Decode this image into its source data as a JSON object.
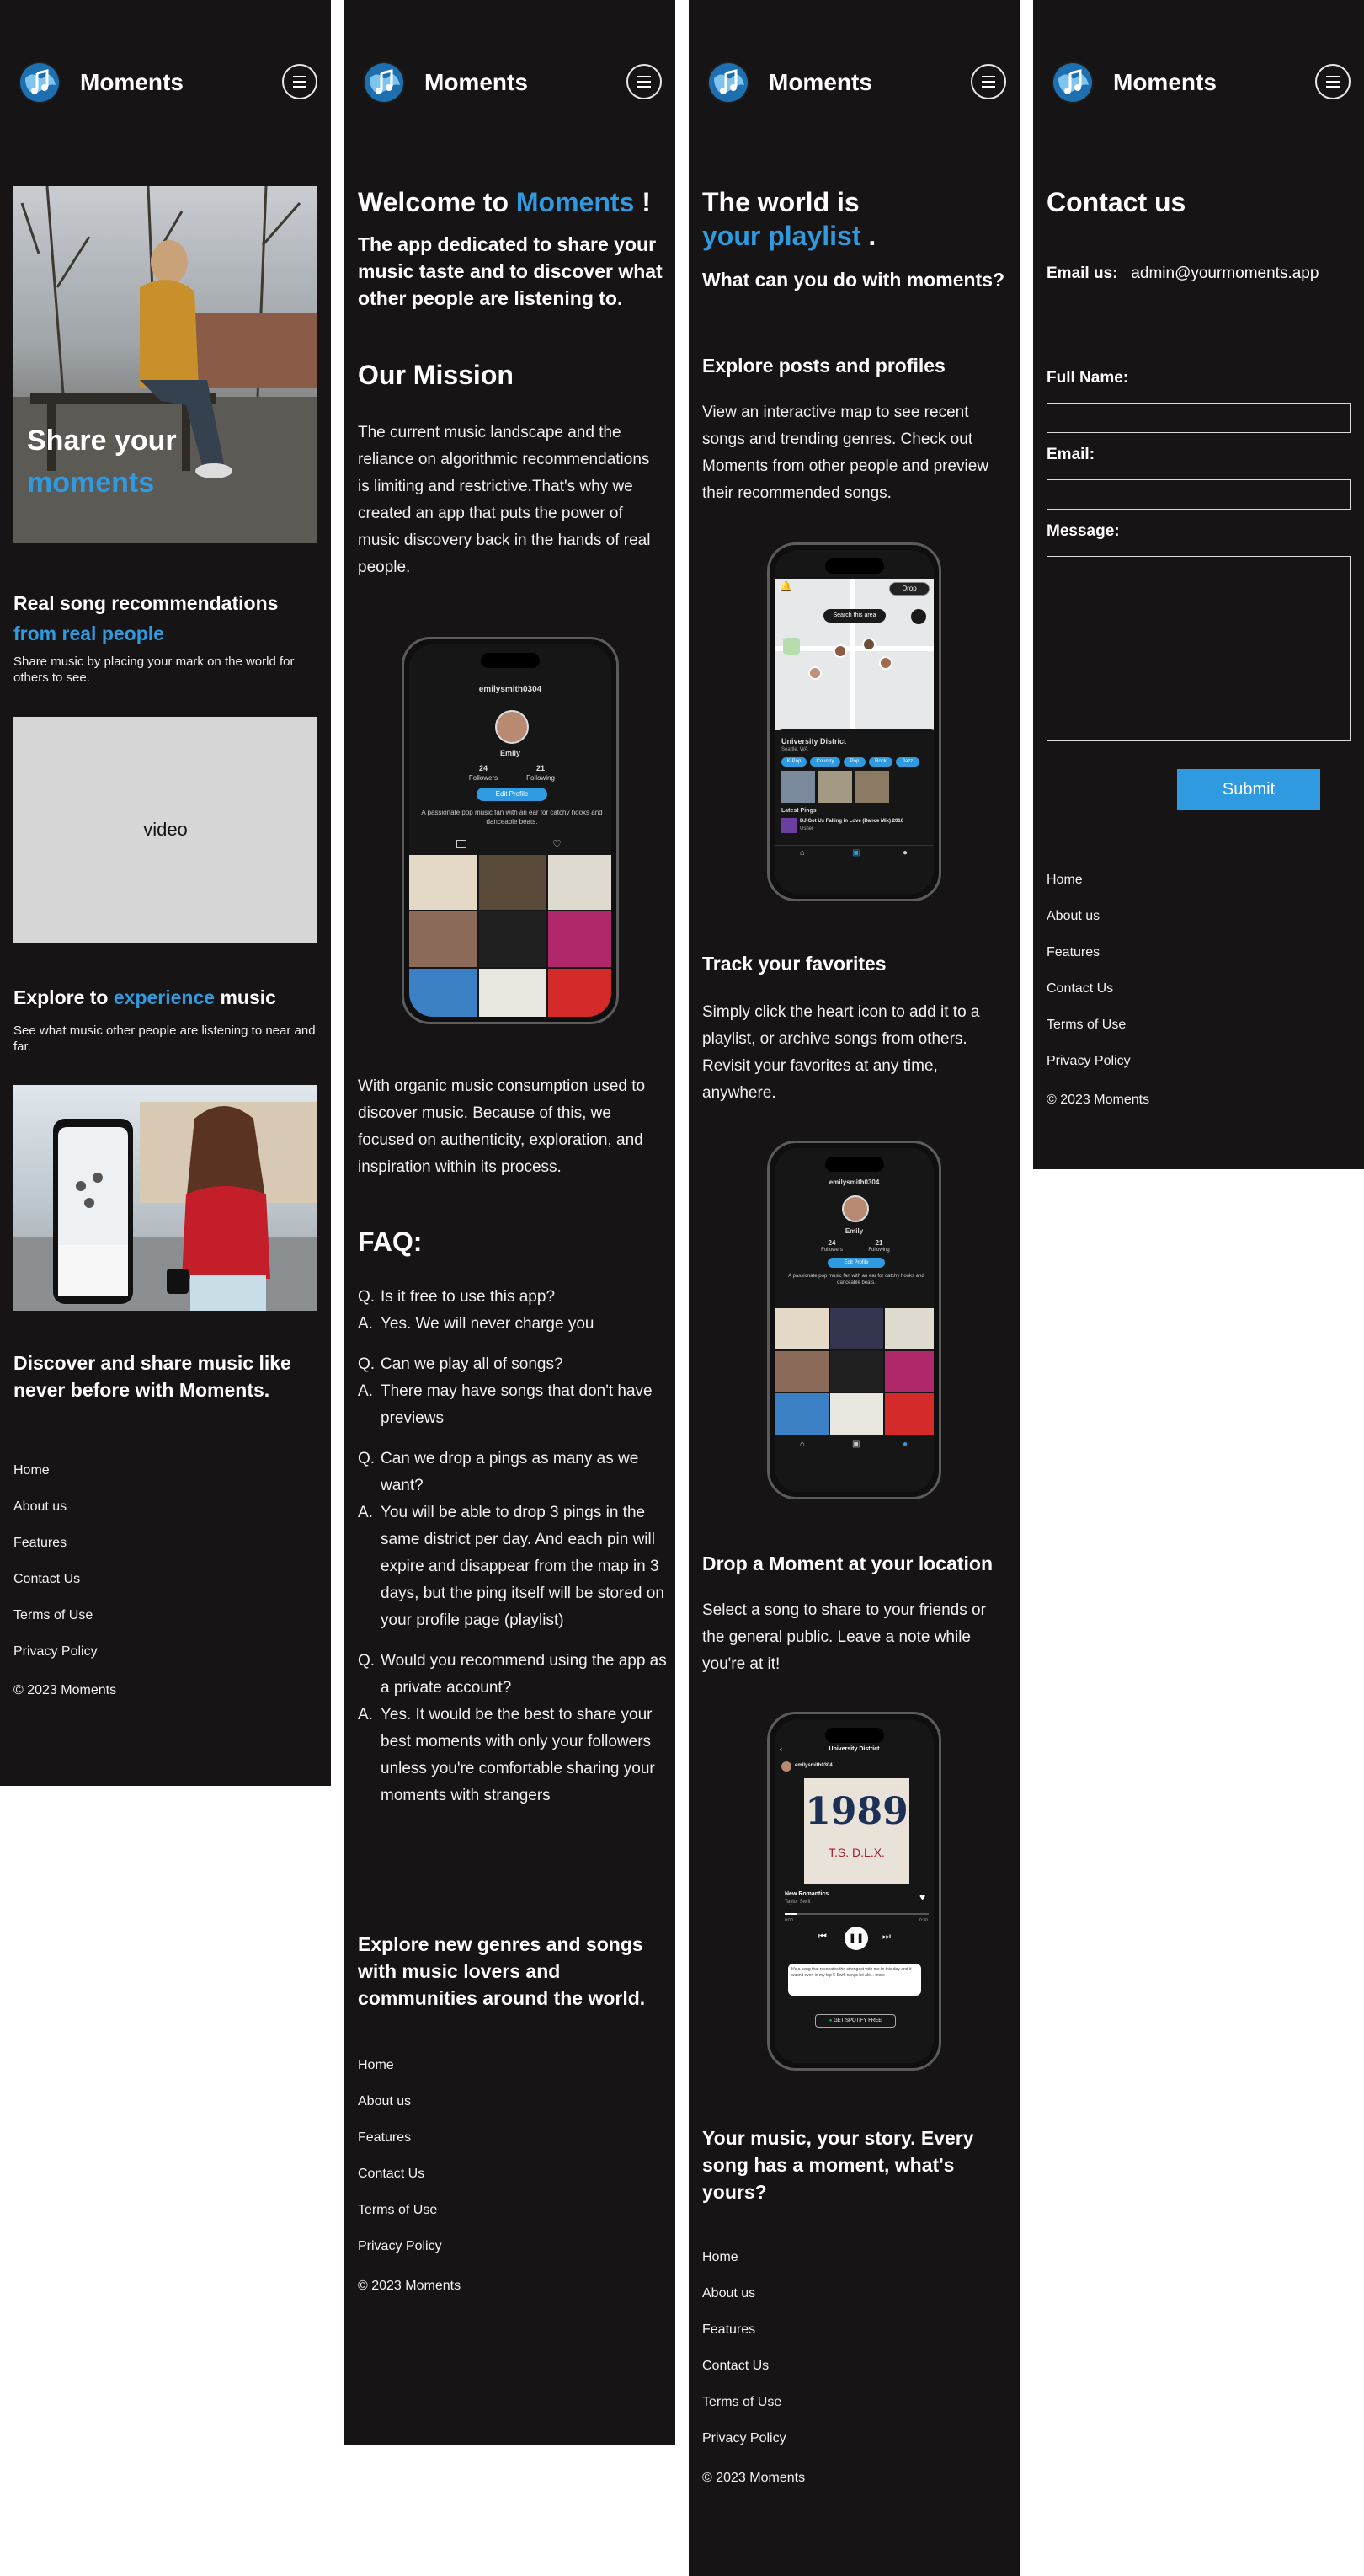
{
  "brand": {
    "name": "Moments"
  },
  "icons": {
    "logo": "globe-music-note-icon",
    "menu": "hamburger-menu-icon"
  },
  "colors": {
    "accent": "#2f9ae0",
    "background": "#161414"
  },
  "home": {
    "hero_line1": "Share your",
    "hero_line2": "moments",
    "rec_title": "Real song recommendations",
    "rec_title_accent": "from real people",
    "rec_desc": "Share music by placing your mark on the world for others to see.",
    "video_label": "video",
    "explore_pre": "Explore to",
    "explore_accent": "experience",
    "explore_post": "music",
    "explore_desc": "See what music other people are listening to near and far.",
    "discover": "Discover and share music like never before with Moments."
  },
  "about": {
    "welcome_pre": "Welcome to",
    "welcome_accent": "Moments",
    "welcome_post": "!",
    "intro": "The app dedicated to share your music taste and to discover what other people are listening to.",
    "mission_title": "Our Mission",
    "mission_text": "The current music landscape and the reliance on algorithmic recommendations is limiting and restrictive.That's why we created an app that puts the power of music discovery back in the hands of real people.",
    "organic_text": "With organic music consumption used to discover music. Because of this, we focused on authenticity, exploration, and inspiration within its process.",
    "faq_title": "FAQ:",
    "faq": [
      {
        "q": "Is it free to use this app?",
        "a": "Yes. We will never charge you"
      },
      {
        "q": "Can we play all of songs?",
        "a": "There may have songs that don't have previews"
      },
      {
        "q": "Can we drop a pings as many as we want?",
        "a": "You will be able to drop 3 pings in the same district per day. And each pin will expire and disappear from the map in 3 days, but the ping itself will be stored on your profile page (playlist)"
      },
      {
        "q": "Would you recommend using the app as a private account?",
        "a": "Yes. It would be the best to share your best moments with only your followers unless you're comfortable sharing your moments with strangers"
      }
    ],
    "faq_q": "Q.",
    "faq_a": "A.",
    "closing": "Explore new genres and songs with music lovers and communities around the world."
  },
  "features": {
    "title_line1": "The world is",
    "title_accent": "your playlist",
    "title_dot": ".",
    "question": "What can you do with moments?",
    "f1_title": "Explore posts and profiles",
    "f1_text": "View an interactive map to see recent songs and trending genres. Check out Moments from other people and preview their recommended songs.",
    "f2_title": "Track your favorites",
    "f2_text": "Simply click the heart icon to add it to a playlist, or archive songs from others. Revisit your favorites at any time, anywhere.",
    "f3_title": "Drop a Moment at your location",
    "f3_text": "Select a song to share to your friends or the general public. Leave a note while you're at it!",
    "closing": "Your music, your story. Every song has a moment, what's yours?"
  },
  "phone_profile": {
    "username": "emilysmith0304",
    "name": "Emily",
    "followers_count": "24",
    "followers_label": "Followers",
    "following_count": "21",
    "following_label": "Following",
    "edit_profile": "Edit Profile",
    "bio": "A passionate pop music fan with an ear for catchy hooks and danceable beats."
  },
  "phone_map": {
    "drop": "Drop",
    "search": "Search this area",
    "district": "University District",
    "district_sub": "Seattle, WA",
    "tags": [
      "K-Pop",
      "Country",
      "Pop",
      "Rock",
      "Jazz"
    ],
    "latest": "Latest Pings",
    "song": "DJ Got Us Falling in Love (Dance Mix) 2016",
    "artist": "Usher"
  },
  "phone_song": {
    "district": "University District",
    "username": "emilysmith0304",
    "album_text": "1989",
    "album_sub": "T.S.   D.L.X.",
    "song_title": "New Romantics",
    "artist": "Taylor Swift",
    "time_start": "0:00",
    "time_end": "0:30",
    "note": "It's a song that resonates the strongest with me to this day and it wasn't even in my top 5 Swift songs let alo... more",
    "spotify": "GET SPOTIFY FREE"
  },
  "contact": {
    "title": "Contact us",
    "email_label": "Email us:",
    "email_value": "admin@yourmoments.app",
    "full_name_label": "Full Name:",
    "email_field_label": "Email:",
    "message_label": "Message:",
    "submit": "Submit"
  },
  "footer": {
    "links": [
      "Home",
      "About us",
      "Features",
      "Contact Us",
      "Terms of Use",
      "Privacy Policy"
    ],
    "copyright": "© 2023 Moments"
  }
}
